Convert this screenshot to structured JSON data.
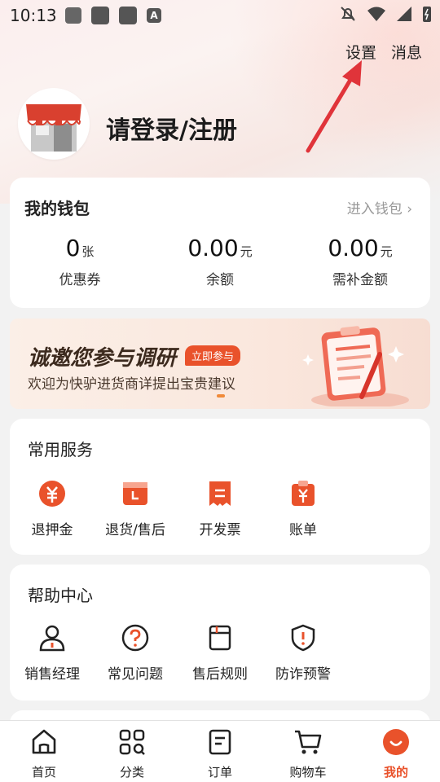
{
  "status_bar": {
    "time": "10:13",
    "a_glyph": "A"
  },
  "header": {
    "settings_label": "设置",
    "messages_label": "消息",
    "login_label": "请登录/注册"
  },
  "wallet": {
    "title": "我的钱包",
    "enter_label": "进入钱包 ›",
    "items": [
      {
        "value": "0",
        "unit": "张",
        "label": "优惠券"
      },
      {
        "value": "0.00",
        "unit": "元",
        "label": "余额"
      },
      {
        "value": "0.00",
        "unit": "元",
        "label": "需补金额"
      }
    ]
  },
  "banner": {
    "title": "诚邀您参与调研",
    "badge": "立即参与",
    "subtitle": "欢迎为快驴进货商详提出宝贵建议"
  },
  "services": {
    "title": "常用服务",
    "items": [
      {
        "label": "退押金",
        "icon": "deposit-refund-icon"
      },
      {
        "label": "退货/售后",
        "icon": "return-icon"
      },
      {
        "label": "开发票",
        "icon": "invoice-icon"
      },
      {
        "label": "账单",
        "icon": "bill-icon"
      }
    ]
  },
  "help": {
    "title": "帮助中心",
    "items": [
      {
        "label": "销售经理",
        "icon": "sales-manager-icon"
      },
      {
        "label": "常见问题",
        "icon": "faq-icon"
      },
      {
        "label": "售后规则",
        "icon": "after-sales-rules-icon"
      },
      {
        "label": "防诈预警",
        "icon": "anti-fraud-icon"
      }
    ]
  },
  "tabbar": {
    "tabs": [
      {
        "label": "首页",
        "icon": "home-icon"
      },
      {
        "label": "分类",
        "icon": "category-icon"
      },
      {
        "label": "订单",
        "icon": "orders-icon"
      },
      {
        "label": "购物车",
        "icon": "cart-icon"
      },
      {
        "label": "我的",
        "icon": "profile-icon",
        "active": true
      }
    ]
  },
  "colors": {
    "accent": "#e9522b",
    "arrow": "#e0343a"
  }
}
